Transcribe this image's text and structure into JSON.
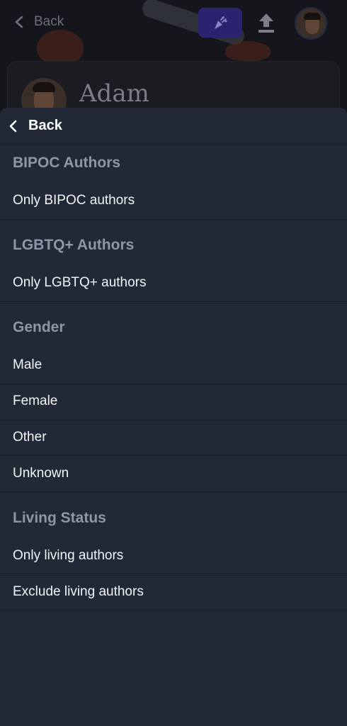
{
  "background": {
    "back_label": "Back",
    "profile_name": "Adam",
    "icons": {
      "back": "chevron-left-icon",
      "party": "party-popper-icon",
      "upload": "upload-icon",
      "avatar": "user-avatar"
    }
  },
  "sheet": {
    "back_label": "Back",
    "sections": [
      {
        "title": "BIPOC Authors",
        "options": [
          "Only BIPOC authors"
        ]
      },
      {
        "title": "LGBTQ+ Authors",
        "options": [
          "Only LGBTQ+ authors"
        ]
      },
      {
        "title": "Gender",
        "options": [
          "Male",
          "Female",
          "Other",
          "Unknown"
        ]
      },
      {
        "title": "Living Status",
        "options": [
          "Only living authors",
          "Exclude living authors"
        ]
      }
    ]
  },
  "colors": {
    "sheet_bg": "#222836",
    "section_title": "#8e95a3",
    "option_text": "#f3f4f6",
    "divider": "#151a24",
    "accent": "#2a2470"
  }
}
